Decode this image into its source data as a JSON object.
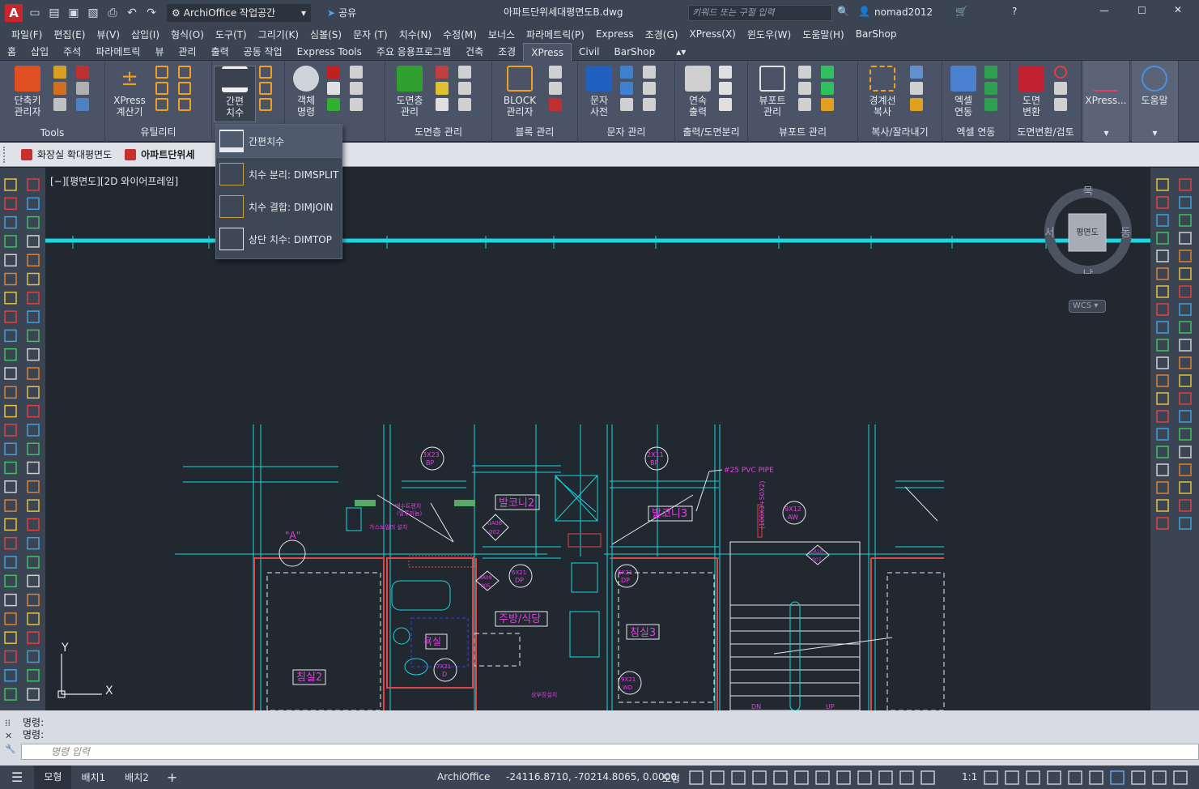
{
  "title_bar": {
    "workspace": "ArchiOffice 작업공간",
    "share": "공유",
    "document_title": "아파트단위세대평면도B.dwg",
    "search_placeholder": "키워드 또는 구절 입력",
    "user": "nomad2012"
  },
  "menu": [
    "파일(F)",
    "편집(E)",
    "뷰(V)",
    "삽입(I)",
    "형식(O)",
    "도구(T)",
    "그리기(K)",
    "심볼(S)",
    "문자 (T)",
    "치수(N)",
    "수정(M)",
    "보너스",
    "파라메트릭(P)",
    "Express",
    "조경(G)",
    "XPress(X)",
    "윈도우(W)",
    "도움말(H)",
    "BarShop"
  ],
  "ribbon_tabs": [
    "홈",
    "삽입",
    "주석",
    "파라메트릭",
    "뷰",
    "관리",
    "출력",
    "공동 작업",
    "Express Tools",
    "주요 응용프로그램",
    "건축",
    "조경",
    "XPress",
    "Civil",
    "BarShop"
  ],
  "active_tab": "XPress",
  "ribbon": {
    "panels": [
      {
        "label": "Tools",
        "buttons": [
          "단축키\n관리자"
        ]
      },
      {
        "label": "유틸리티",
        "buttons": [
          "XPress\n계산기"
        ]
      },
      {
        "label": "",
        "buttons": [
          "간편\n치수"
        ]
      },
      {
        "label": "",
        "buttons": [
          "객체\n명령"
        ]
      },
      {
        "label": "도면층 관리",
        "buttons": [
          "도면층\n관리"
        ]
      },
      {
        "label": "블록 관리",
        "buttons": [
          "BLOCK\n관리자"
        ]
      },
      {
        "label": "문자 관리",
        "buttons": [
          "문자\n사전"
        ]
      },
      {
        "label": "출력/도면분리",
        "buttons": [
          "연속\n출력"
        ]
      },
      {
        "label": "뷰포트 관리",
        "buttons": [
          "뷰포트\n관리"
        ]
      },
      {
        "label": "복사/잘라내기",
        "buttons": [
          "경계선\n복사"
        ]
      },
      {
        "label": "엑셀 연동",
        "buttons": [
          "엑셀\n연동"
        ]
      },
      {
        "label": "도면변환/검토",
        "buttons": [
          "도면\n변환"
        ]
      },
      {
        "label": "",
        "buttons": [
          "XPress..."
        ]
      },
      {
        "label": "",
        "buttons": [
          "도움말"
        ]
      }
    ]
  },
  "dropdown": {
    "items": [
      "간편치수",
      "치수 분리: DIMSPLIT",
      "치수 결합: DIMJOIN",
      "상단 치수: DIMTOP"
    ]
  },
  "file_tabs": [
    "화장실 확대평면도",
    "아파트단위세"
  ],
  "viewport": {
    "label": "[−][평면도][2D 와이어프레임]",
    "viewcube": {
      "north": "북",
      "south": "남",
      "east": "동",
      "west": "서",
      "face": "평면도",
      "wcs": "WCS"
    },
    "ucs": {
      "x": "X",
      "y": "Y"
    }
  },
  "drawing_labels": {
    "a_mark": "\"A\"",
    "balcony2": "발코니2",
    "balcony3": "발코니3",
    "kitchen": "주방/식당",
    "bath": "욕실",
    "bedroom2": "침실2",
    "bedroom3": "침실3",
    "pipe": "#25 PVC PIPE",
    "dim_v": "(100X3+50X2)",
    "tag_3x23": "3X23",
    "tag_bp": "BP",
    "tag_2x11": "2X11",
    "tag_9x12": "9X12",
    "tag_aw": "AW",
    "tag_6x21": "6X21",
    "tag_dp": "DP",
    "tag_7x21": "7X21",
    "tag_d": "D",
    "tag_9x21": "9X21",
    "tag_wd": "WD",
    "tag_0a06": "0A06",
    "tag_002": "002",
    "tag_0a09": "0A09",
    "tag_005": "005",
    "tag_0a10": "0A10",
    "tag_007": "007",
    "note1": "배수트렌치",
    "note1b": "(알루미늄)",
    "note2": "가스보일러 설치",
    "note3": "상부장설치",
    "stair_dn": "DN",
    "stair_up": "UP"
  },
  "command": {
    "history": [
      "명령:",
      "명령:"
    ],
    "placeholder": "명령 입력"
  },
  "status": {
    "tabs": [
      "모형",
      "배치1",
      "배치2"
    ],
    "app": "ArchiOffice",
    "coordinates": "-24116.8710, -70214.8065, 0.0000",
    "model": "모형",
    "scale": "1:1"
  },
  "colors": {
    "cyan": "#19d6e0",
    "magenta": "#e040e0",
    "red": "#e04848",
    "white": "#e6e9ee",
    "background": "#212830"
  }
}
